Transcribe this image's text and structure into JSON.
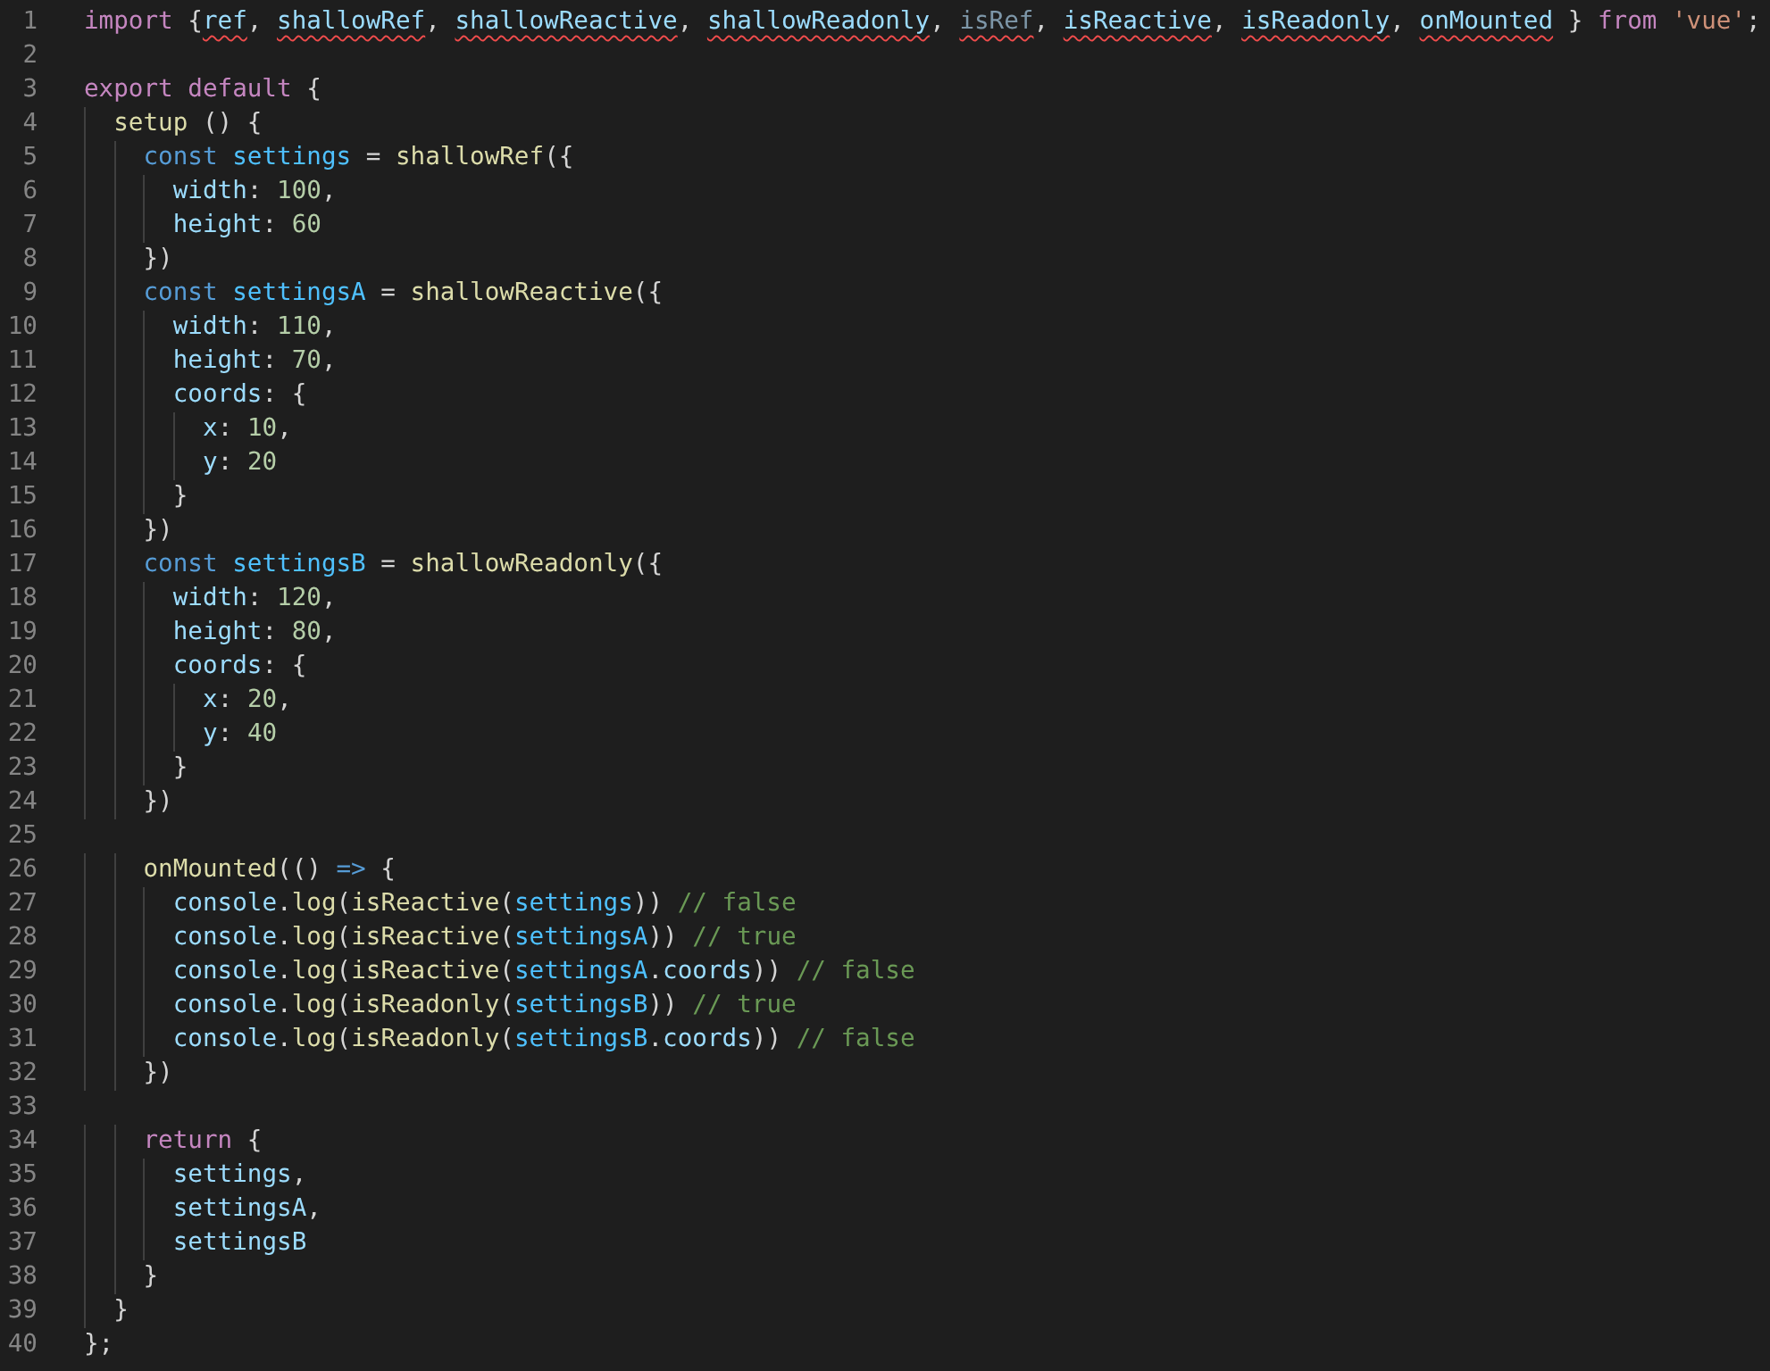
{
  "editor": {
    "lines": [
      {
        "number": "1",
        "tokens": [
          {
            "text": "import",
            "kind": "kw"
          },
          {
            "text": " {",
            "kind": "p"
          },
          {
            "text": "ref",
            "kind": "imp"
          },
          {
            "text": ", ",
            "kind": "p"
          },
          {
            "text": "shallowRef",
            "kind": "imp"
          },
          {
            "text": ", ",
            "kind": "p"
          },
          {
            "text": "shallowReactive",
            "kind": "imp"
          },
          {
            "text": ", ",
            "kind": "p"
          },
          {
            "text": "shallowReadonly",
            "kind": "imp"
          },
          {
            "text": ", ",
            "kind": "p"
          },
          {
            "text": "isRef",
            "kind": "unused"
          },
          {
            "text": ", ",
            "kind": "p"
          },
          {
            "text": "isReactive",
            "kind": "imp"
          },
          {
            "text": ", ",
            "kind": "p"
          },
          {
            "text": "isReadonly",
            "kind": "imp"
          },
          {
            "text": ", ",
            "kind": "p"
          },
          {
            "text": "onMounted",
            "kind": "imp"
          },
          {
            "text": " } ",
            "kind": "p"
          },
          {
            "text": "from",
            "kind": "kw"
          },
          {
            "text": " 'vue'",
            "kind": "str"
          },
          {
            "text": ";",
            "kind": "p"
          }
        ]
      },
      {
        "number": "2"
      },
      {
        "number": "3",
        "tokens": [
          {
            "text": "export",
            "kind": "kw"
          },
          {
            "text": " default",
            "kind": "kw"
          },
          {
            "text": " {",
            "kind": "p"
          }
        ]
      },
      {
        "number": "4",
        "tokens": [
          {
            "text": "  setup",
            "kind": "fn"
          },
          {
            "text": " () {",
            "kind": "p"
          }
        ]
      },
      {
        "number": "5",
        "tokens": [
          {
            "text": "    const",
            "kind": "st"
          },
          {
            "text": " settings",
            "kind": "cv"
          },
          {
            "text": " = ",
            "kind": "p"
          },
          {
            "text": "shallowRef",
            "kind": "fn"
          },
          {
            "text": "({",
            "kind": "p"
          }
        ]
      },
      {
        "number": "6",
        "tokens": [
          {
            "text": "      width",
            "kind": "var"
          },
          {
            "text": ": ",
            "kind": "p"
          },
          {
            "text": "100",
            "kind": "num"
          },
          {
            "text": ",",
            "kind": "p"
          }
        ]
      },
      {
        "number": "7",
        "tokens": [
          {
            "text": "      height",
            "kind": "var"
          },
          {
            "text": ": ",
            "kind": "p"
          },
          {
            "text": "60",
            "kind": "num"
          }
        ]
      },
      {
        "number": "8",
        "tokens": [
          {
            "text": "    })",
            "kind": "p"
          }
        ]
      },
      {
        "number": "9",
        "tokens": [
          {
            "text": "    const",
            "kind": "st"
          },
          {
            "text": " settingsA",
            "kind": "cv"
          },
          {
            "text": " = ",
            "kind": "p"
          },
          {
            "text": "shallowReactive",
            "kind": "fn"
          },
          {
            "text": "({",
            "kind": "p"
          }
        ]
      },
      {
        "number": "10",
        "tokens": [
          {
            "text": "      width",
            "kind": "var"
          },
          {
            "text": ": ",
            "kind": "p"
          },
          {
            "text": "110",
            "kind": "num"
          },
          {
            "text": ",",
            "kind": "p"
          }
        ]
      },
      {
        "number": "11",
        "tokens": [
          {
            "text": "      height",
            "kind": "var"
          },
          {
            "text": ": ",
            "kind": "p"
          },
          {
            "text": "70",
            "kind": "num"
          },
          {
            "text": ",",
            "kind": "p"
          }
        ]
      },
      {
        "number": "12",
        "tokens": [
          {
            "text": "      coords",
            "kind": "var"
          },
          {
            "text": ": {",
            "kind": "p"
          }
        ]
      },
      {
        "number": "13",
        "tokens": [
          {
            "text": "        x",
            "kind": "var"
          },
          {
            "text": ": ",
            "kind": "p"
          },
          {
            "text": "10",
            "kind": "num"
          },
          {
            "text": ",",
            "kind": "p"
          }
        ]
      },
      {
        "number": "14",
        "tokens": [
          {
            "text": "        y",
            "kind": "var"
          },
          {
            "text": ": ",
            "kind": "p"
          },
          {
            "text": "20",
            "kind": "num"
          }
        ]
      },
      {
        "number": "15",
        "tokens": [
          {
            "text": "      }",
            "kind": "p"
          }
        ]
      },
      {
        "number": "16",
        "tokens": [
          {
            "text": "    })",
            "kind": "p"
          }
        ]
      },
      {
        "number": "17",
        "tokens": [
          {
            "text": "    const",
            "kind": "st"
          },
          {
            "text": " settingsB",
            "kind": "cv"
          },
          {
            "text": " = ",
            "kind": "p"
          },
          {
            "text": "shallowReadonly",
            "kind": "fn"
          },
          {
            "text": "({",
            "kind": "p"
          }
        ]
      },
      {
        "number": "18",
        "tokens": [
          {
            "text": "      width",
            "kind": "var"
          },
          {
            "text": ": ",
            "kind": "p"
          },
          {
            "text": "120",
            "kind": "num"
          },
          {
            "text": ",",
            "kind": "p"
          }
        ]
      },
      {
        "number": "19",
        "tokens": [
          {
            "text": "      height",
            "kind": "var"
          },
          {
            "text": ": ",
            "kind": "p"
          },
          {
            "text": "80",
            "kind": "num"
          },
          {
            "text": ",",
            "kind": "p"
          }
        ]
      },
      {
        "number": "20",
        "tokens": [
          {
            "text": "      coords",
            "kind": "var"
          },
          {
            "text": ": {",
            "kind": "p"
          }
        ]
      },
      {
        "number": "21",
        "tokens": [
          {
            "text": "        x",
            "kind": "var"
          },
          {
            "text": ": ",
            "kind": "p"
          },
          {
            "text": "20",
            "kind": "num"
          },
          {
            "text": ",",
            "kind": "p"
          }
        ]
      },
      {
        "number": "22",
        "tokens": [
          {
            "text": "        y",
            "kind": "var"
          },
          {
            "text": ": ",
            "kind": "p"
          },
          {
            "text": "40",
            "kind": "num"
          }
        ]
      },
      {
        "number": "23",
        "tokens": [
          {
            "text": "      }",
            "kind": "p"
          }
        ]
      },
      {
        "number": "24",
        "tokens": [
          {
            "text": "    })",
            "kind": "p"
          }
        ]
      },
      {
        "number": "25"
      },
      {
        "number": "26",
        "tokens": [
          {
            "text": "    onMounted",
            "kind": "fn"
          },
          {
            "text": "(() ",
            "kind": "p"
          },
          {
            "text": "=>",
            "kind": "st"
          },
          {
            "text": " {",
            "kind": "p"
          }
        ]
      },
      {
        "number": "27",
        "tokens": [
          {
            "text": "      console",
            "kind": "var"
          },
          {
            "text": ".",
            "kind": "p"
          },
          {
            "text": "log",
            "kind": "fn"
          },
          {
            "text": "(",
            "kind": "p"
          },
          {
            "text": "isReactive",
            "kind": "fn"
          },
          {
            "text": "(",
            "kind": "p"
          },
          {
            "text": "settings",
            "kind": "cv"
          },
          {
            "text": ")) ",
            "kind": "p"
          },
          {
            "text": "// false",
            "kind": "com"
          }
        ]
      },
      {
        "number": "28",
        "tokens": [
          {
            "text": "      console",
            "kind": "var"
          },
          {
            "text": ".",
            "kind": "p"
          },
          {
            "text": "log",
            "kind": "fn"
          },
          {
            "text": "(",
            "kind": "p"
          },
          {
            "text": "isReactive",
            "kind": "fn"
          },
          {
            "text": "(",
            "kind": "p"
          },
          {
            "text": "settingsA",
            "kind": "cv"
          },
          {
            "text": ")) ",
            "kind": "p"
          },
          {
            "text": "// true",
            "kind": "com"
          }
        ]
      },
      {
        "number": "29",
        "tokens": [
          {
            "text": "      console",
            "kind": "var"
          },
          {
            "text": ".",
            "kind": "p"
          },
          {
            "text": "log",
            "kind": "fn"
          },
          {
            "text": "(",
            "kind": "p"
          },
          {
            "text": "isReactive",
            "kind": "fn"
          },
          {
            "text": "(",
            "kind": "p"
          },
          {
            "text": "settingsA",
            "kind": "cv"
          },
          {
            "text": ".",
            "kind": "p"
          },
          {
            "text": "coords",
            "kind": "var"
          },
          {
            "text": ")) ",
            "kind": "p"
          },
          {
            "text": "// false",
            "kind": "com"
          }
        ]
      },
      {
        "number": "30",
        "tokens": [
          {
            "text": "      console",
            "kind": "var"
          },
          {
            "text": ".",
            "kind": "p"
          },
          {
            "text": "log",
            "kind": "fn"
          },
          {
            "text": "(",
            "kind": "p"
          },
          {
            "text": "isReadonly",
            "kind": "fn"
          },
          {
            "text": "(",
            "kind": "p"
          },
          {
            "text": "settingsB",
            "kind": "cv"
          },
          {
            "text": ")) ",
            "kind": "p"
          },
          {
            "text": "// true",
            "kind": "com"
          }
        ]
      },
      {
        "number": "31",
        "tokens": [
          {
            "text": "      console",
            "kind": "var"
          },
          {
            "text": ".",
            "kind": "p"
          },
          {
            "text": "log",
            "kind": "fn"
          },
          {
            "text": "(",
            "kind": "p"
          },
          {
            "text": "isReadonly",
            "kind": "fn"
          },
          {
            "text": "(",
            "kind": "p"
          },
          {
            "text": "settingsB",
            "kind": "cv"
          },
          {
            "text": ".",
            "kind": "p"
          },
          {
            "text": "coords",
            "kind": "var"
          },
          {
            "text": ")) ",
            "kind": "p"
          },
          {
            "text": "// false",
            "kind": "com"
          }
        ]
      },
      {
        "number": "32",
        "tokens": [
          {
            "text": "    })",
            "kind": "p"
          }
        ]
      },
      {
        "number": "33"
      },
      {
        "number": "34",
        "tokens": [
          {
            "text": "    return",
            "kind": "kw"
          },
          {
            "text": " {",
            "kind": "p"
          }
        ]
      },
      {
        "number": "35",
        "tokens": [
          {
            "text": "      settings",
            "kind": "var"
          },
          {
            "text": ",",
            "kind": "p"
          }
        ]
      },
      {
        "number": "36",
        "tokens": [
          {
            "text": "      settingsA",
            "kind": "var"
          },
          {
            "text": ",",
            "kind": "p"
          }
        ]
      },
      {
        "number": "37",
        "tokens": [
          {
            "text": "      settingsB",
            "kind": "var"
          }
        ]
      },
      {
        "number": "38",
        "tokens": [
          {
            "text": "    }",
            "kind": "p"
          }
        ]
      },
      {
        "number": "39",
        "tokens": [
          {
            "text": "  }",
            "kind": "p"
          }
        ]
      },
      {
        "number": "40",
        "tokens": [
          {
            "text": "};",
            "kind": "p"
          }
        ]
      }
    ]
  }
}
